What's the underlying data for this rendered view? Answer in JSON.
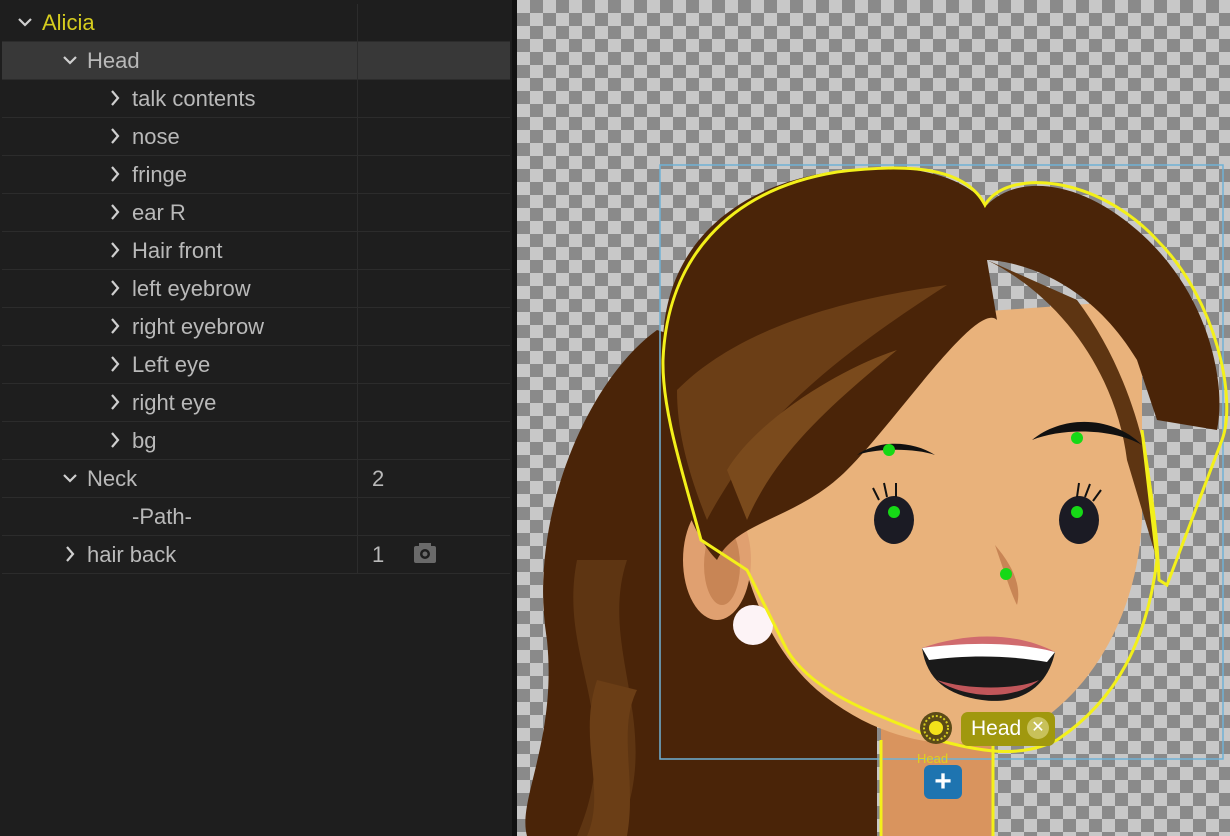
{
  "layers": [
    {
      "label": "Alicia",
      "indent": 0,
      "chevron": "down",
      "highlight": true
    },
    {
      "label": "Head",
      "indent": 1,
      "chevron": "down",
      "selected": true
    },
    {
      "label": "talk contents",
      "indent": 2,
      "chevron": "right"
    },
    {
      "label": "nose",
      "indent": 2,
      "chevron": "right"
    },
    {
      "label": "fringe",
      "indent": 2,
      "chevron": "right"
    },
    {
      "label": "ear R",
      "indent": 2,
      "chevron": "right"
    },
    {
      "label": "Hair front",
      "indent": 2,
      "chevron": "right"
    },
    {
      "label": "left eyebrow",
      "indent": 2,
      "chevron": "right"
    },
    {
      "label": "right eyebrow",
      "indent": 2,
      "chevron": "right"
    },
    {
      "label": "Left eye",
      "indent": 2,
      "chevron": "right"
    },
    {
      "label": "right eye",
      "indent": 2,
      "chevron": "right"
    },
    {
      "label": "bg",
      "indent": 2,
      "chevron": "right"
    },
    {
      "label": "Neck",
      "indent": 1,
      "chevron": "down",
      "count": "2"
    },
    {
      "label": "-Path-",
      "indent": 2,
      "chevron": "none"
    },
    {
      "label": "hair back",
      "indent": 1,
      "chevron": "right",
      "count": "1",
      "camera": true
    }
  ],
  "stage": {
    "tag_label": "Head",
    "tag_close_icon": "close-icon",
    "handle_label": "Head",
    "add_handle_icon": "plus-icon",
    "origin_icon": "sun-origin-icon"
  },
  "colors": {
    "accent": "#d6cd1e",
    "selection_outline": "#f3f01a",
    "bounding_box": "#6fb1d6",
    "hair": "#4a2408",
    "skin": "#e9b27b",
    "handle_dot": "#16d916"
  }
}
